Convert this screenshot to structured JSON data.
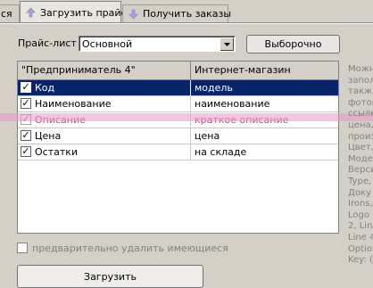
{
  "tabs": [
    {
      "label": "ся",
      "icon": "",
      "active": false
    },
    {
      "label": "Загрузить прайс",
      "icon": "arrow-up-icon",
      "active": true
    },
    {
      "label": "Получить заказы",
      "icon": "arrow-down-icon",
      "active": false
    }
  ],
  "price_list": {
    "label": "Прайс-лист",
    "value": "Основной",
    "selective_button": "Выборочно"
  },
  "grid": {
    "headers": [
      "\"Предприниматель 4\"",
      "Интернет-магазин"
    ],
    "rows": [
      {
        "checked": true,
        "field": "Код",
        "target": "модель",
        "state": "selected"
      },
      {
        "checked": true,
        "field": "Наименование",
        "target": "наименование",
        "state": "normal"
      },
      {
        "checked": true,
        "field": "Описание",
        "target": "краткое описание",
        "state": "highlighted"
      },
      {
        "checked": true,
        "field": "Цена",
        "target": "цена",
        "state": "normal"
      },
      {
        "checked": true,
        "field": "Остатки",
        "target": "на складе",
        "state": "normal"
      }
    ]
  },
  "help_lines": [
    "Можн",
    "запол",
    "такж",
    "фотог",
    "ссылк",
    "цена,",
    "произ",
    "Цвет,",
    "Моде",
    "Верси",
    "Type,",
    "Доку",
    "Irons,",
    "Logo F",
    "2, Line",
    "Line 4,",
    "Option",
    "Key: ("
  ],
  "delete_existing": {
    "checked": false,
    "label": "предварительно удалить имеющиеся"
  },
  "load_button": "Загрузить",
  "colors": {
    "selection": "#0a246a",
    "highlight": "#e896c8",
    "window": "#d4d0c8"
  }
}
